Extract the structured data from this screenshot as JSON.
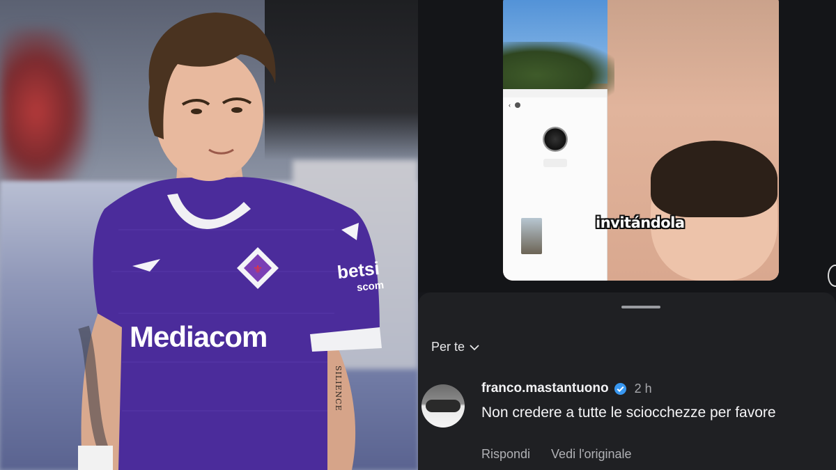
{
  "left_photo": {
    "jersey_sponsor": "Mediacom",
    "sleeve_sponsor": "betsi",
    "sleeve_sponsor_sub": "scom",
    "tattoo_text": "SILIENCE"
  },
  "video": {
    "caption": "invitándola",
    "embedded_chat": {
      "title": "",
      "lines": []
    }
  },
  "comments_sheet": {
    "filter_label": "Per te",
    "comment": {
      "username": "franco.mastantuono",
      "time": "2 h",
      "text": "Non credere a tutte le sciocchezze per favore",
      "reply_label": "Rispondi",
      "see_original_label": "Vedi l'originale"
    }
  },
  "colors": {
    "jersey_purple": "#4b2c9b",
    "sheet_bg": "#1f2023",
    "verified_blue": "#3897f0"
  }
}
